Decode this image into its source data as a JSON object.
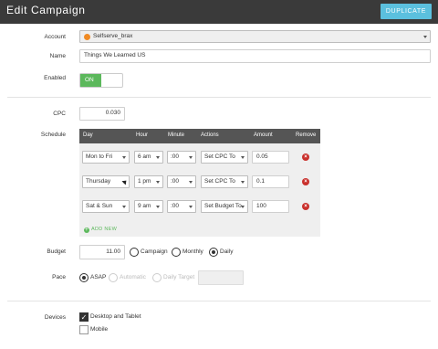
{
  "header": {
    "title": "Edit Campaign",
    "duplicate_label": "DUPLICATE"
  },
  "labels": {
    "account": "Account",
    "name": "Name",
    "enabled": "Enabled",
    "cpc": "CPC",
    "schedule": "Schedule",
    "budget": "Budget",
    "pace": "Pace",
    "devices": "Devices"
  },
  "account": {
    "value": "Selfserve_brax",
    "icon": "account-icon"
  },
  "name": {
    "value": "Things We Learned US"
  },
  "enabled": {
    "label": "ON",
    "state": true
  },
  "cpc": {
    "value": "0.030"
  },
  "schedule": {
    "columns": [
      "Day",
      "Hour",
      "Minute",
      "Actions",
      "Amount",
      "Remove"
    ],
    "rows": [
      {
        "day": "Mon to Fri",
        "hour": "6 am",
        "minute": ":00",
        "action": "Set CPC To",
        "amount": "0.05"
      },
      {
        "day": "Thursday",
        "hour": "1 pm",
        "minute": ":00",
        "action": "Set CPC To",
        "amount": "0.1"
      },
      {
        "day": "Sat & Sun",
        "hour": "9 am",
        "minute": ":00",
        "action": "Set Budget To",
        "amount": "100"
      }
    ],
    "add_new": "ADD NEW"
  },
  "budget": {
    "value": "11.00",
    "options": [
      "Campaign",
      "Monthly",
      "Daily"
    ],
    "selected": "Daily"
  },
  "pace": {
    "options": [
      "ASAP",
      "Automatic",
      "Daily Target"
    ],
    "selected": "ASAP",
    "target_value": ""
  },
  "devices": {
    "options": [
      "Desktop and Tablet",
      "Mobile"
    ],
    "checked": [
      "Desktop and Tablet"
    ]
  },
  "colors": {
    "header_bg": "#3a3a3a",
    "accent": "#5bc0de",
    "toggle_on": "#5cb85c",
    "remove": "#c9302c"
  }
}
